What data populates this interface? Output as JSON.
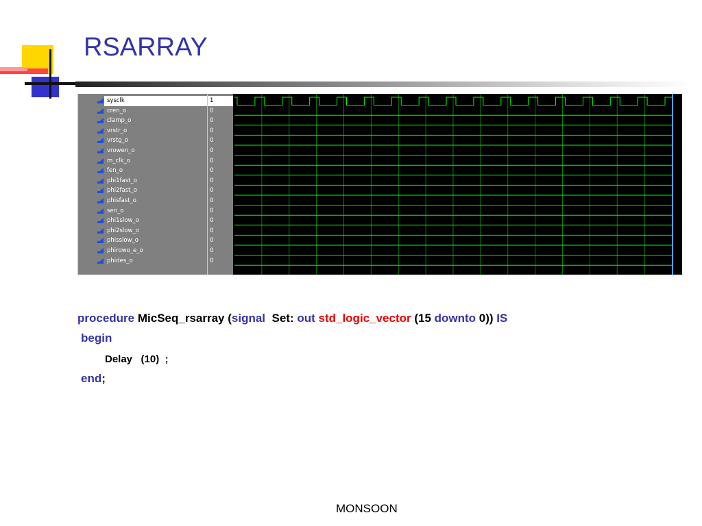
{
  "slide": {
    "title": "RSARRAY",
    "footer": "MONSOON"
  },
  "waveform": {
    "signals": [
      {
        "name": "sysclk",
        "value": "1",
        "selected": true
      },
      {
        "name": "cren_o",
        "value": "0"
      },
      {
        "name": "clamp_o",
        "value": "0"
      },
      {
        "name": "vrstr_o",
        "value": "0"
      },
      {
        "name": "vrstg_o",
        "value": "0"
      },
      {
        "name": "vrowen_o",
        "value": "0"
      },
      {
        "name": "m_clk_o",
        "value": "0"
      },
      {
        "name": "fen_o",
        "value": "0"
      },
      {
        "name": "phi1fast_o",
        "value": "0"
      },
      {
        "name": "phi2fast_o",
        "value": "0"
      },
      {
        "name": "phisfast_o",
        "value": "0"
      },
      {
        "name": "sen_o",
        "value": "0"
      },
      {
        "name": "phi1slow_o",
        "value": "0"
      },
      {
        "name": "phi2slow_o",
        "value": "0"
      },
      {
        "name": "phisslow_o",
        "value": "0"
      },
      {
        "name": "phirowo_e_o",
        "value": "0"
      },
      {
        "name": "phides_o",
        "value": "0"
      }
    ],
    "clock_periods": 16,
    "colors": {
      "trace": "#00ff00",
      "grid": "#008000",
      "background": "#000000",
      "cursor": "#4fa0ff",
      "icon": "#1a4fe0"
    }
  },
  "code": {
    "line1": {
      "kw1": "procedure",
      "name": "MicSeq_rsarray (",
      "kw2": "signal",
      "t1": "  Set: ",
      "kw3": "out",
      "type": "std_logic_vector",
      "t2": " (15 ",
      "kw4": "downto",
      "t3": " 0)) ",
      "kw5": "IS"
    },
    "line2": {
      "kw": "begin"
    },
    "line3": {
      "text": "Delay   (10)  ;"
    },
    "line4": {
      "kw": "end",
      "t": ";"
    }
  }
}
